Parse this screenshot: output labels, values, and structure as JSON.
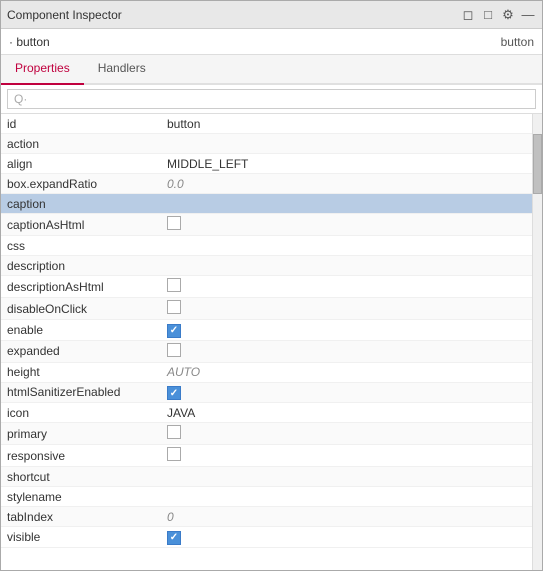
{
  "window": {
    "title": "Component Inspector",
    "component_name": "· button",
    "component_type": "button"
  },
  "tabs": [
    {
      "label": "Properties",
      "active": true
    },
    {
      "label": "Handlers",
      "active": false
    }
  ],
  "search": {
    "placeholder": "Q·"
  },
  "properties": [
    {
      "name": "id",
      "value": "button",
      "type": "text",
      "italic": false
    },
    {
      "name": "action",
      "value": "",
      "type": "text",
      "italic": false
    },
    {
      "name": "align",
      "value": "MIDDLE_LEFT",
      "type": "text",
      "italic": false
    },
    {
      "name": "box.expandRatio",
      "value": "0.0",
      "type": "text",
      "italic": true
    },
    {
      "name": "caption",
      "value": "",
      "type": "text",
      "highlighted": true
    },
    {
      "name": "captionAsHtml",
      "value": "",
      "type": "checkbox",
      "checked": false
    },
    {
      "name": "css",
      "value": "",
      "type": "text"
    },
    {
      "name": "description",
      "value": "",
      "type": "text"
    },
    {
      "name": "descriptionAsHtml",
      "value": "",
      "type": "checkbox",
      "checked": false
    },
    {
      "name": "disableOnClick",
      "value": "",
      "type": "checkbox",
      "checked": false
    },
    {
      "name": "enable",
      "value": "",
      "type": "checkbox",
      "checked": true
    },
    {
      "name": "expanded",
      "value": "",
      "type": "checkbox",
      "checked": false
    },
    {
      "name": "height",
      "value": "AUTO",
      "type": "text",
      "italic": true
    },
    {
      "name": "htmlSanitizerEnabled",
      "value": "",
      "type": "checkbox",
      "checked": true
    },
    {
      "name": "icon",
      "value": "JAVA",
      "type": "text",
      "italic": false
    },
    {
      "name": "primary",
      "value": "",
      "type": "checkbox",
      "checked": false
    },
    {
      "name": "responsive",
      "value": "",
      "type": "checkbox",
      "checked": false
    },
    {
      "name": "shortcut",
      "value": "",
      "type": "text"
    },
    {
      "name": "stylename",
      "value": "",
      "type": "text"
    },
    {
      "name": "tabIndex",
      "value": "0",
      "type": "text",
      "italic": true
    },
    {
      "name": "visible",
      "value": "",
      "type": "checkbox",
      "checked": true
    }
  ],
  "icons": {
    "restore": "⧉",
    "maximize": "□",
    "settings": "⚙",
    "close": "─"
  }
}
